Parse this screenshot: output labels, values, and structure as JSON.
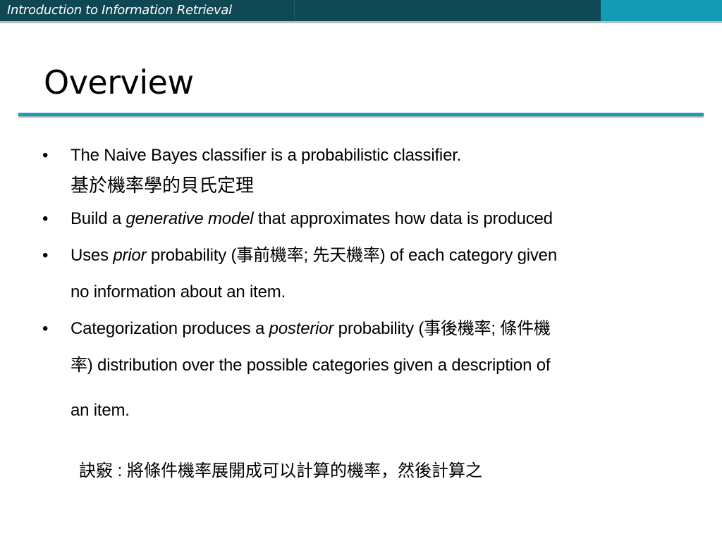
{
  "header": {
    "course_title": "Introduction to Information Retrieval",
    "colors": {
      "dark": "#0f4753",
      "accent": "#139bb5"
    }
  },
  "slide": {
    "title": "Overview",
    "bullets": [
      {
        "text": "The Naive Bayes classifier is a probabilistic classifier.",
        "sub": "基於機率學的貝氏定理"
      },
      {
        "pre": "Build a ",
        "emph": "generative model",
        "post": " that approximates how data is produced"
      },
      {
        "pre": "Uses ",
        "emph": "prior",
        "post_line1": " probability (事前機率; 先天機率) of each category given",
        "post_line2": "no information about an item."
      },
      {
        "pre": "Categorization produces a ",
        "emph": "posterior",
        "post_line1": " probability (事後機率; 條件機",
        "post_line2": "率) distribution over the possible categories given a description of",
        "post_line3": "an item."
      }
    ],
    "note": "訣竅 : 將條件機率展開成可以計算的機率，然後計算之"
  }
}
